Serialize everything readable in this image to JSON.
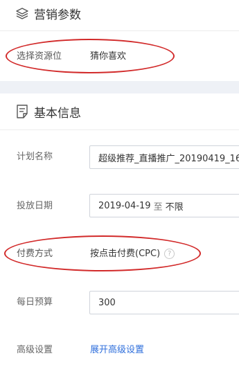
{
  "marketing": {
    "title": "营销参数",
    "resource_label": "选择资源位",
    "resource_value": "猜你喜欢"
  },
  "basic": {
    "title": "基本信息",
    "plan_name_label": "计划名称",
    "plan_name_value": "超级推荐_直播推广_20190419_16",
    "date_label": "投放日期",
    "date_start": "2019-04-19",
    "date_to": "至",
    "date_end": "不限",
    "pay_label": "付费方式",
    "pay_value": "按点击付费(CPC)",
    "budget_label": "每日预算",
    "budget_value": "300",
    "advanced_label": "高级设置",
    "advanced_link": "展开高级设置"
  },
  "annotation_color": "#d22a2a"
}
